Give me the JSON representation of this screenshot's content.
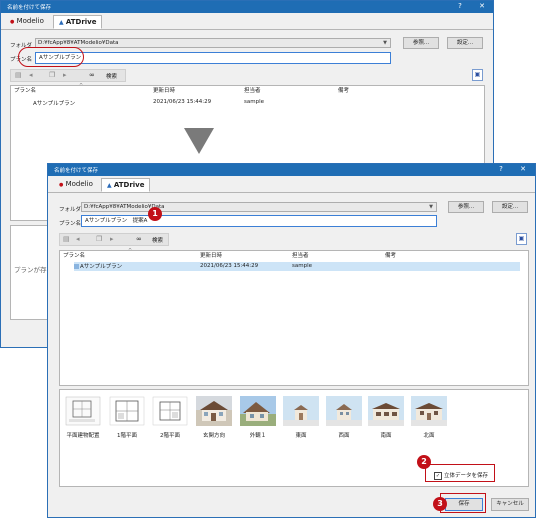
{
  "back": {
    "title": "名前を付けて保存",
    "help_button": "?",
    "close_button": "✕",
    "tabs": [
      "Modelio",
      "ATDrive"
    ],
    "folder_label": "フォルダ",
    "folder_path": "D:¥fcApp¥8¥ATModelio¥Data",
    "browse_button": "参照...",
    "settings_button": "設定...",
    "plan_label": "プラン名",
    "plan_name": "Aサンプルプラン",
    "search_label": "検索",
    "columns": [
      "プラン名",
      "更新日時",
      "担当者",
      "備考"
    ],
    "rows": [
      [
        "Aサンプルプラン",
        "2021/06/23 15:44:29",
        "sample",
        ""
      ]
    ],
    "partial_text": "プランが存"
  },
  "front": {
    "title": "名前を付けて保存",
    "help_button": "?",
    "close_button": "✕",
    "tabs": [
      "Modelio",
      "ATDrive"
    ],
    "folder_label": "フォルダ",
    "folder_path": "D:¥fcApp¥8¥ATModelio¥Data",
    "browse_button": "参照...",
    "settings_button": "設定...",
    "plan_label": "プラン名",
    "plan_name": "Aサンプルプラン　提案A",
    "search_label": "検索",
    "columns": [
      "プラン名",
      "更新日時",
      "担当者",
      "備考"
    ],
    "rows": [
      [
        "Aサンプルプラン",
        "2021/06/23 15:44:29",
        "sample",
        ""
      ]
    ],
    "thumbnails": [
      "平面建物配置",
      "1階平面",
      "2階平面",
      "玄関方向",
      "外観１",
      "東面",
      "西面",
      "南面",
      "北面"
    ],
    "save_3d_label": "立体データを保存",
    "save_3d_checked": true,
    "save_button": "保存",
    "cancel_button": "キャンセル"
  },
  "callouts": [
    "1",
    "2",
    "3"
  ],
  "colors": {
    "titlebar": "#1f6db4",
    "callout": "#c21018",
    "selection": "#cde4f7"
  }
}
